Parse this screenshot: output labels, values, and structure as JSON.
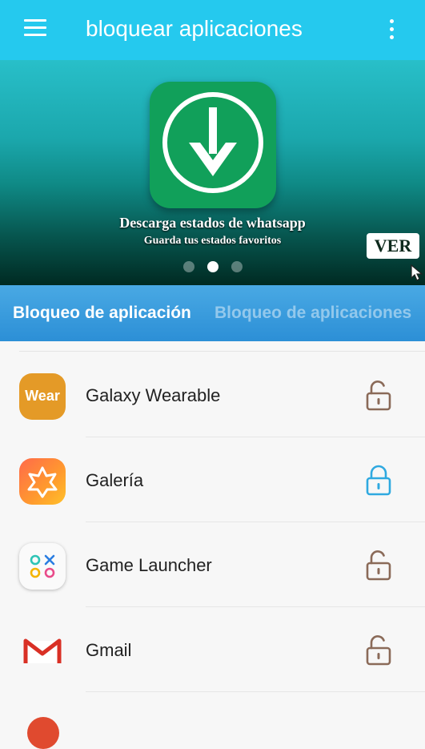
{
  "app_bar": {
    "title": "bloquear aplicaciones",
    "background": "#25c9ee",
    "menu_icon": "hamburger-menu-icon",
    "overflow_icon": "more-vert-icon"
  },
  "banner": {
    "title": "Descarga estados de whatsapp",
    "subtitle": "Guarda tus estados favoritos",
    "cta_label": "VER",
    "icon": "download-arrow-icon",
    "carousel": {
      "count": 3,
      "active_index": 1
    }
  },
  "tabs": [
    {
      "label": "Bloqueo de aplicación",
      "active": true
    },
    {
      "label": "Bloqueo de aplicaciones",
      "active": false
    }
  ],
  "apps": [
    {
      "name": "Galaxy Wearable",
      "icon": "galaxy-wearable-icon",
      "icon_text": "Wear",
      "locked": false
    },
    {
      "name": "Galería",
      "icon": "gallery-icon",
      "locked": true
    },
    {
      "name": "Game Launcher",
      "icon": "game-launcher-icon",
      "locked": false
    },
    {
      "name": "Gmail",
      "icon": "gmail-icon",
      "locked": false
    }
  ],
  "colors": {
    "unlocked_lock": "#8a6a58",
    "locked_lock": "#2fa9e0",
    "tab_bar": "#3a9ee0",
    "banner_cta_text": "#0e2a1d"
  }
}
